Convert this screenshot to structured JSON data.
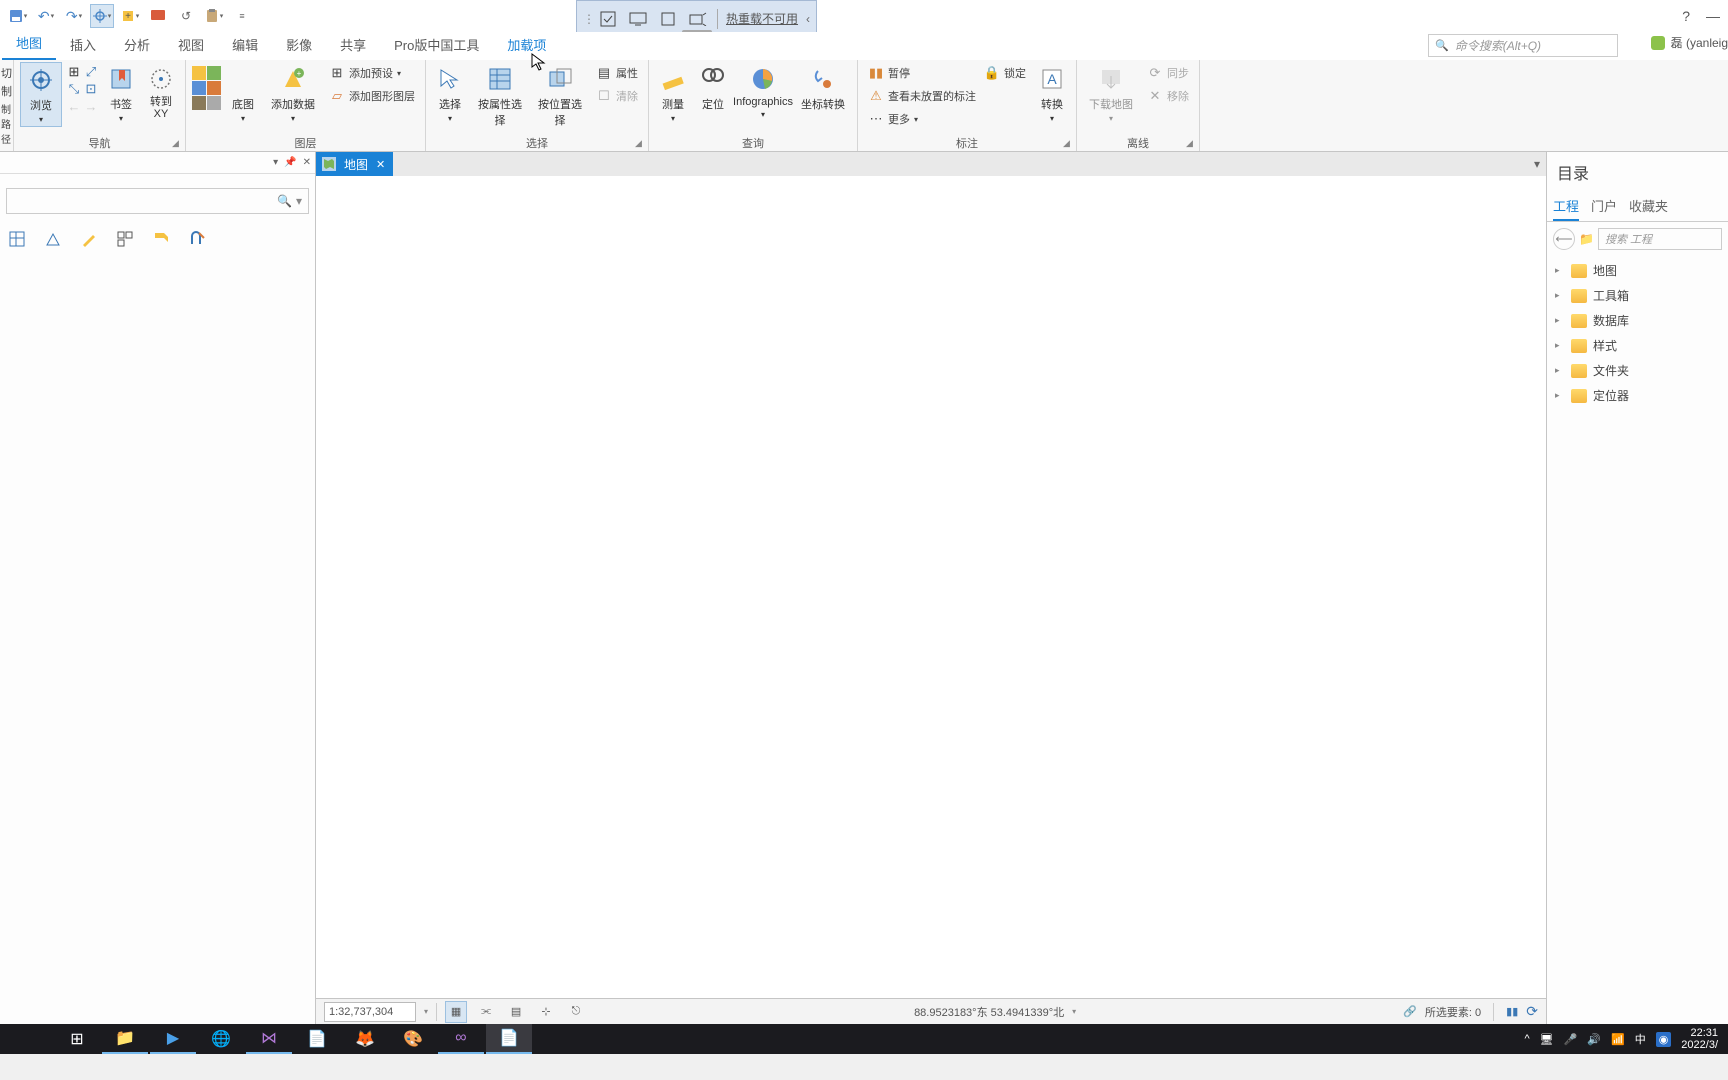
{
  "qat": {
    "undo": "↶",
    "redo": "↷"
  },
  "debug": {
    "hotreload": "热重载不可用"
  },
  "titlebar": {
    "help": "?",
    "minimize": "—"
  },
  "tabs": {
    "map": "地图",
    "insert": "插入",
    "analysis": "分析",
    "view": "视图",
    "edit": "编辑",
    "imagery": "影像",
    "share": "共享",
    "cntools": "Pro版中国工具",
    "addins": "加载项"
  },
  "search": {
    "placeholder": "命令搜索(Alt+Q)"
  },
  "user": {
    "name": "磊 (yanleig"
  },
  "ribbon": {
    "nav": {
      "label": "导航",
      "cut": "切",
      "制": "制",
      "path": "制路径",
      "explore": "浏览",
      "bookmarks": "书签",
      "goto": "转到\nXY"
    },
    "layer": {
      "label": "图层",
      "basemap": "底图",
      "adddata": "添加数据",
      "addpreset": "添加预设",
      "addgraphic": "添加图形图层"
    },
    "select": {
      "label": "选择",
      "select": "选择",
      "byattr": "按属性选择",
      "byloc": "按位置选择",
      "attrs": "属性",
      "clear": "清除"
    },
    "query": {
      "label": "查询",
      "measure": "测量",
      "locate": "定位",
      "info": "Infographics",
      "coord": "坐标转换"
    },
    "label": {
      "group": "标注",
      "pause": "暂停",
      "lock": "锁定",
      "unplaced": "查看未放置的标注",
      "more": "更多",
      "convert": "转换"
    },
    "offline": {
      "group": "离线",
      "download": "下载地图",
      "sync": "同步",
      "remove": "移除"
    }
  },
  "leftpanel": {
    "placeholder": ""
  },
  "doctab": {
    "map": "地图"
  },
  "catalog": {
    "title": "目录",
    "tabs": {
      "project": "工程",
      "portal": "门户",
      "fav": "收藏夹"
    },
    "search": "搜索 工程",
    "items": {
      "maps": "地图",
      "toolboxes": "工具箱",
      "databases": "数据库",
      "styles": "样式",
      "folders": "文件夹",
      "locators": "定位器"
    }
  },
  "status": {
    "scale": "1:32,737,304",
    "coords": "88.9523183°东 53.4941339°北",
    "selected": "所选要素: 0"
  },
  "tray": {
    "ime": "中",
    "time": "22:31",
    "date": "2022/3/"
  }
}
